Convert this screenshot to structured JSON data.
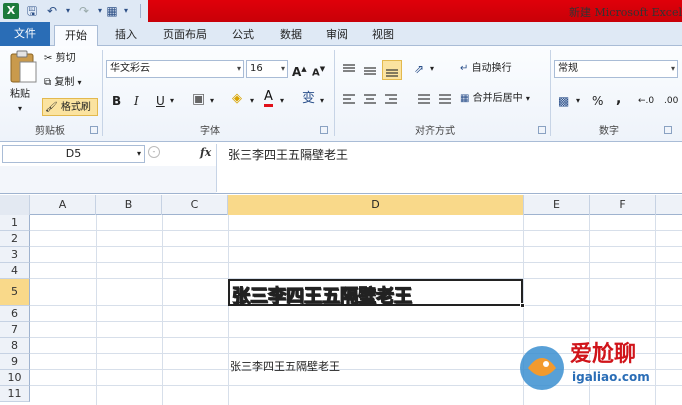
{
  "window": {
    "title": "新建 Microsoft Excel"
  },
  "quick_access": {
    "logo": "X"
  },
  "tabs": [
    "文件",
    "开始",
    "插入",
    "页面布局",
    "公式",
    "数据",
    "审阅",
    "视图"
  ],
  "clipboard": {
    "paste": "粘贴",
    "cut": "剪切",
    "copy": "复制",
    "format_painter": "格式刷",
    "label": "剪贴板"
  },
  "font": {
    "name": "华文彩云",
    "size": "16",
    "grow": "A",
    "shrink": "A",
    "bold": "B",
    "italic": "I",
    "underline": "U",
    "phonetic": "变",
    "label": "字体"
  },
  "alignment": {
    "wrap": "自动换行",
    "merge": "合并后居中",
    "label": "对齐方式"
  },
  "number": {
    "format": "常规",
    "percent": "%",
    "comma": ",",
    "label": "数字"
  },
  "formula_bar": {
    "cell_ref": "D5",
    "fx": "fx",
    "content": "张三李四王五隔壁老王"
  },
  "grid": {
    "columns": [
      "A",
      "B",
      "C",
      "D",
      "E",
      "F"
    ],
    "rows": [
      "1",
      "2",
      "3",
      "4",
      "5",
      "6",
      "7",
      "8",
      "9",
      "10",
      "11"
    ],
    "selected_column": "D",
    "selected_row": "5",
    "cells": {
      "D5": "张三李四王五隔壁老王",
      "D9": "张三李四王五隔壁老王"
    }
  },
  "watermark": {
    "text1": "爱尬聊",
    "text2": "igaliao.com"
  },
  "colors": {
    "file_tab": "#2a6db6",
    "title_bar": "#d8000a",
    "selection": "#f9d98a"
  }
}
